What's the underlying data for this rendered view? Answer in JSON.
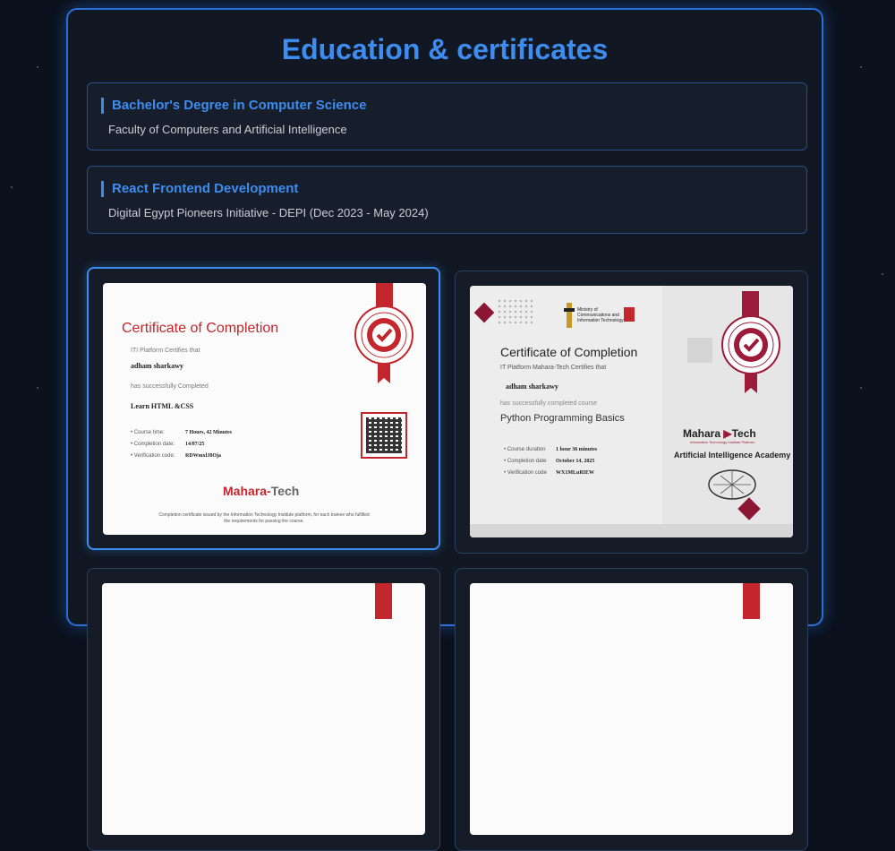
{
  "section": {
    "title": "Education & certificates"
  },
  "education": [
    {
      "title": "Bachelor's Degree in Computer Science",
      "subtitle": "Faculty of Computers and Artificial Intelligence"
    },
    {
      "title": "React Frontend Development",
      "subtitle": "Digital Egypt Pioneers Initiative - DEPI (Dec 2023 - May 2024)"
    }
  ],
  "certificates": [
    {
      "heading": "Certificate of Completion",
      "platform_line": "ITI Platform Certifies that",
      "name": "adham sharkawy",
      "completed_line": "has successfully Completed",
      "course": "Learn HTML &CSS",
      "rows": [
        {
          "label": "Course time:",
          "value": "7 Hours, 42 Minutes"
        },
        {
          "label": "Completion date:",
          "value": "14/07/25"
        },
        {
          "label": "Verification code:",
          "value": "RDWmxlJ8Oja"
        }
      ],
      "logo_a": "Mahara-",
      "logo_b": "Tech",
      "footer": "Completion certificate issued by the Information Technology Institute platform, for each trainee who fulfilled the requirements for passing the course."
    },
    {
      "heading": "Certificate of Completion",
      "platform_line": "IT Platform Mahara-Tech Certifies that",
      "name": "adham sharkawy",
      "completed_line": "has successfully completed course",
      "course": "Python Programming Basics",
      "rows": [
        {
          "label": "Course duration",
          "value": "1 hour 36 minutes"
        },
        {
          "label": "Completion date",
          "value": "October 14, 2025"
        },
        {
          "label": "Verification code",
          "value": "WX1MLuRIEW"
        }
      ],
      "ministry": "Ministry of Communications and Information Technology",
      "logo_a": "Mahara",
      "logo_b": "Tech",
      "logo_tagline": "Information Technology Institute Platform",
      "academy": "Artificial Intelligence Academy"
    }
  ],
  "colors": {
    "accent": "#3d8cf0",
    "certificate_red": "#c3262c",
    "background": "#0b111c"
  }
}
